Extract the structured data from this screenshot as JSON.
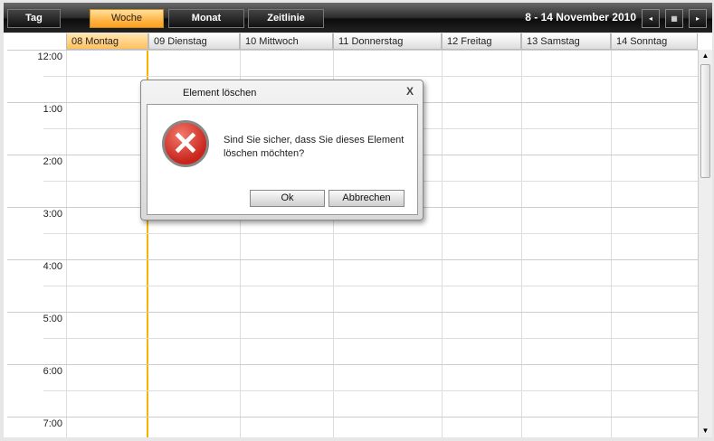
{
  "toolbar": {
    "views": [
      "Tag",
      "Woche",
      "Monat",
      "Zeitlinie"
    ],
    "active_view": "Woche",
    "date_range": "8  - 14 November 2010",
    "prev": "◂",
    "today": "▦",
    "next": "▸"
  },
  "days": [
    "08 Montag",
    "09 Dienstag",
    "10 Mittwoch",
    "11 Donnerstag",
    "12 Freitag",
    "13 Samstag",
    "14 Sonntag"
  ],
  "hours": [
    "12:00",
    "1:00",
    "2:00",
    "3:00",
    "4:00",
    "5:00",
    "6:00",
    "7:00"
  ],
  "dialog": {
    "title": "Element löschen",
    "close": "X",
    "message": "Sind Sie sicher, dass Sie dieses Element löschen möchten?",
    "ok": "Ok",
    "cancel": "Abbrechen"
  },
  "colors": {
    "accent": "#ffb84d",
    "today_line": "#f5b400"
  }
}
